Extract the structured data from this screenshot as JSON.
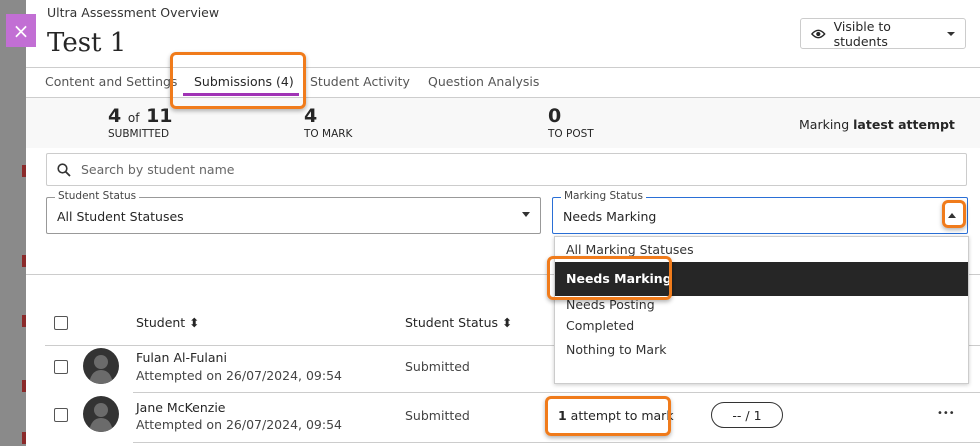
{
  "header": {
    "subtitle": "Ultra Assessment Overview",
    "title": "Test 1",
    "visibility_label": "Visible to students",
    "close_icon": "×"
  },
  "tabs": [
    {
      "label": "Content and Settings"
    },
    {
      "label": "Submissions (4)"
    },
    {
      "label": "Student Activity"
    },
    {
      "label": "Question Analysis"
    }
  ],
  "stats": {
    "submitted": "4",
    "of_word": "of",
    "total": "11",
    "submitted_label": "SUBMITTED",
    "to_mark": "4",
    "to_mark_label": "TO MARK",
    "to_post": "0",
    "to_post_label": "TO POST",
    "marking_prefix": "Marking ",
    "marking_mode": "latest attempt"
  },
  "search": {
    "placeholder": "Search by student name"
  },
  "filters": {
    "student_status": {
      "label": "Student Status",
      "value": "All Student Statuses"
    },
    "marking_status": {
      "label": "Marking Status",
      "value": "Needs Marking",
      "options": [
        "All Marking Statuses",
        "Needs Marking",
        "Needs Posting",
        "Completed",
        "Nothing to Mark"
      ]
    }
  },
  "table": {
    "headers": {
      "student": "Student ⬍",
      "student_status": "Student Status ⬍"
    },
    "rows": [
      {
        "name": "Fulan Al-Fulani",
        "attempted": "Attempted on 26/07/2024, 09:54",
        "status": "Submitted"
      },
      {
        "name": "Jane McKenzie",
        "attempted": "Attempted on 26/07/2024, 09:54",
        "status": "Submitted",
        "mark_count": "1",
        "mark_text": " attempt to mark",
        "grade": "--  / 1",
        "more": "•••"
      }
    ]
  },
  "colors": {
    "accent": "#a033b5",
    "callout": "#f07b1b",
    "close": "#c26fd4"
  }
}
